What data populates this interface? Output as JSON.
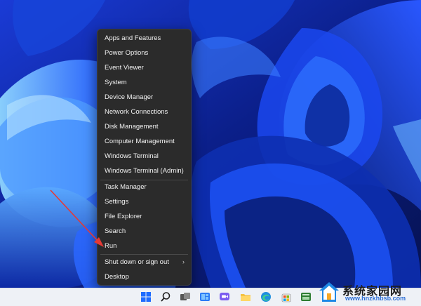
{
  "menu": {
    "items": [
      {
        "label": "Apps and Features"
      },
      {
        "label": "Power Options"
      },
      {
        "label": "Event Viewer"
      },
      {
        "label": "System"
      },
      {
        "label": "Device Manager"
      },
      {
        "label": "Network Connections"
      },
      {
        "label": "Disk Management"
      },
      {
        "label": "Computer Management"
      },
      {
        "label": "Windows Terminal"
      },
      {
        "label": "Windows Terminal (Admin)"
      },
      {
        "label": "Task Manager"
      },
      {
        "label": "Settings"
      },
      {
        "label": "File Explorer"
      },
      {
        "label": "Search"
      },
      {
        "label": "Run"
      },
      {
        "label": "Shut down or sign out",
        "submenu_glyph": "›"
      },
      {
        "label": "Desktop"
      }
    ]
  },
  "annotation": {
    "color": "#e53935",
    "target": "Run"
  },
  "taskbar": {
    "icons": [
      "start-icon",
      "search-icon",
      "task-view-icon",
      "widgets-icon",
      "chat-icon",
      "file-explorer-icon",
      "edge-icon",
      "store-icon",
      "app-icon"
    ]
  },
  "watermark": {
    "text": "系统家园网",
    "url": "www.hnzkhbsb.com"
  },
  "colors": {
    "menu_bg": "#2b2b2b",
    "menu_text": "#f2f2f2",
    "wallpaper_bg": "#0a1a6e",
    "accent": "#1e5bff"
  }
}
